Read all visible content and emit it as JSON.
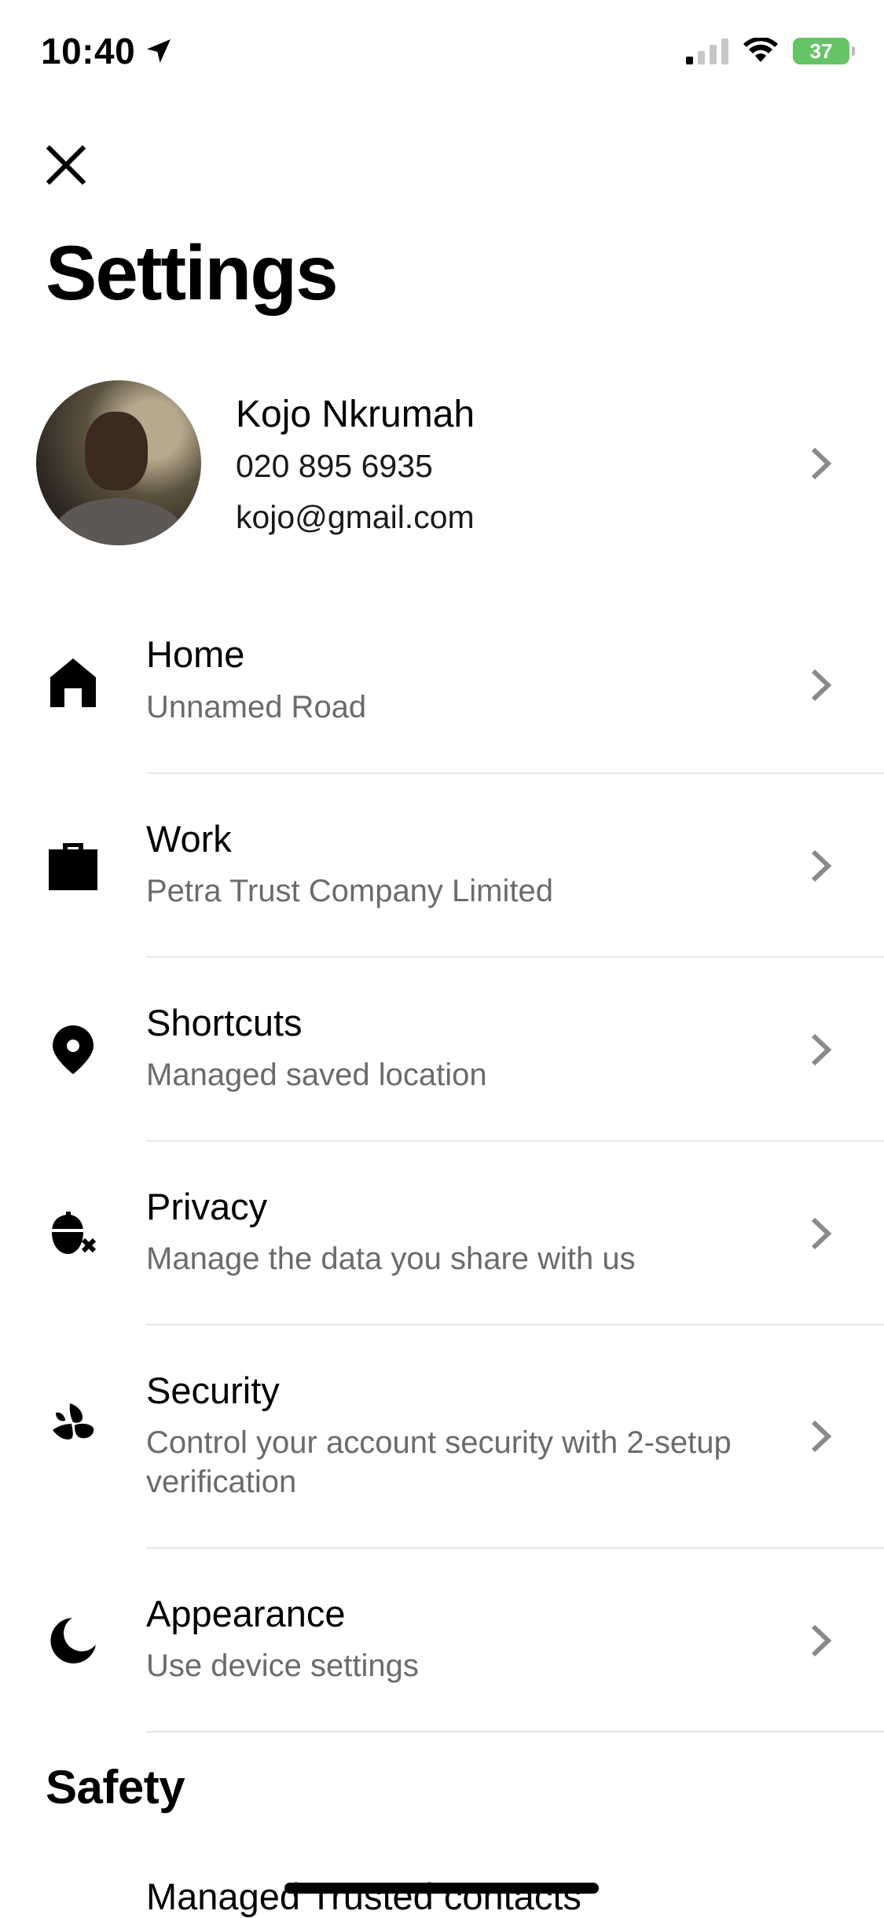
{
  "status_bar": {
    "time": "10:40",
    "battery": "37",
    "battery_color": "#65c466"
  },
  "header": {
    "close_icon": "close-icon",
    "title": "Settings"
  },
  "profile": {
    "name": "Kojo Nkrumah",
    "phone": "020 895 6935",
    "email": "kojo@gmail.com"
  },
  "items": [
    {
      "icon": "home-icon",
      "title": "Home",
      "subtitle": "Unnamed Road"
    },
    {
      "icon": "briefcase-icon",
      "title": "Work",
      "subtitle": "Petra Trust Company Limited"
    },
    {
      "icon": "location-pin-icon",
      "title": "Shortcuts",
      "subtitle": "Managed saved location"
    },
    {
      "icon": "privacy-icon",
      "title": "Privacy",
      "subtitle": "Manage the data you share with us"
    },
    {
      "icon": "security-icon",
      "title": "Security",
      "subtitle": "Control your account security with 2-setup verification"
    },
    {
      "icon": "moon-icon",
      "title": "Appearance",
      "subtitle": "Use device settings"
    }
  ],
  "safety": {
    "section_title": "Safety",
    "trusted_contacts": "Managed Trusted contacts"
  },
  "colors": {
    "text": "#000000",
    "subtext": "#6b6b6b",
    "divider": "#e6e6e6",
    "chevron": "#8a8a8a"
  }
}
